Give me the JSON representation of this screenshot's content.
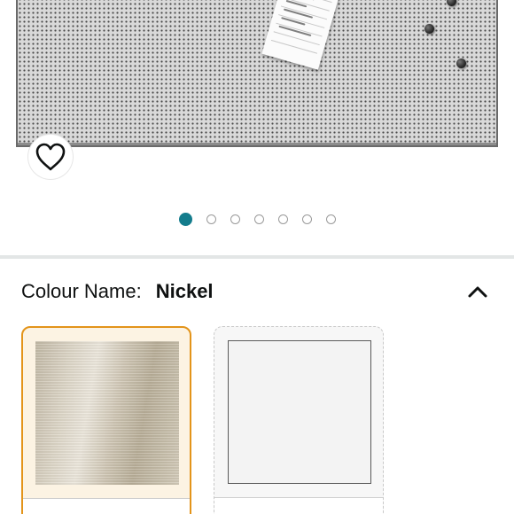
{
  "product_image": {
    "alt": "Magnetic perforated memo board with note and magnets",
    "carousel": {
      "count": 7,
      "active_index": 0
    },
    "wishlist_icon": "heart-outline-icon"
  },
  "variation": {
    "label": "Colour Name:",
    "value": "Nickel",
    "toggle_icon": "chevron-up-icon",
    "swatches": [
      {
        "name": "Nickel",
        "selected": true
      },
      {
        "name": "White",
        "selected": false
      }
    ]
  },
  "colors": {
    "carousel_active": "#137c8c",
    "selected_border": "#e3941a",
    "divider": "#e3e6e6"
  }
}
